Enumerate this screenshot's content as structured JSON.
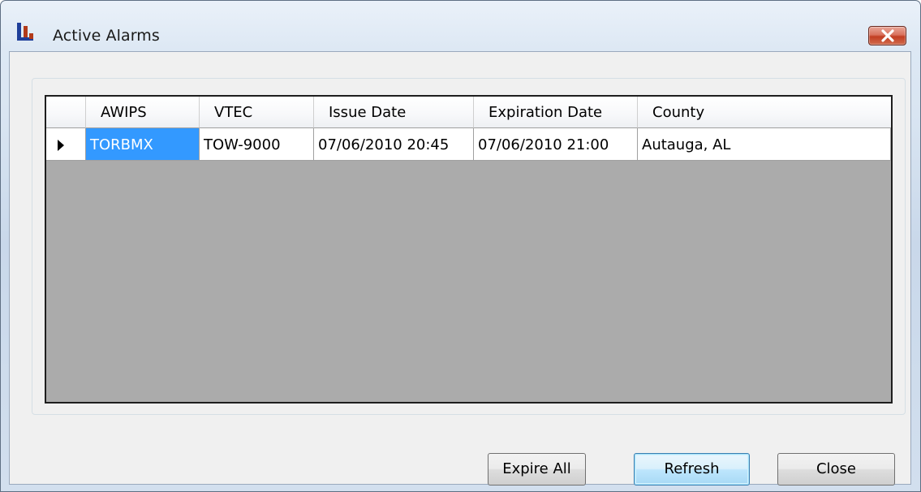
{
  "window": {
    "title": "Active Alarms",
    "app_icon": "chart-bars-icon",
    "close_icon": "close-icon"
  },
  "grid": {
    "columns": [
      "AWIPS",
      "VTEC",
      "Issue Date",
      "Expiration Date",
      "County"
    ],
    "rows": [
      {
        "awips": "TORBMX",
        "vtec": "TOW-9000",
        "issue_date": "07/06/2010 20:45",
        "expiration_date": "07/06/2010 21:00",
        "county": "Autauga, AL",
        "current": true
      }
    ],
    "selected_cell": "awips",
    "selection_color": "#3399ff",
    "empty_area_color": "#ababab"
  },
  "buttons": {
    "expire_all": "Expire All",
    "refresh": "Refresh",
    "close": "Close"
  }
}
